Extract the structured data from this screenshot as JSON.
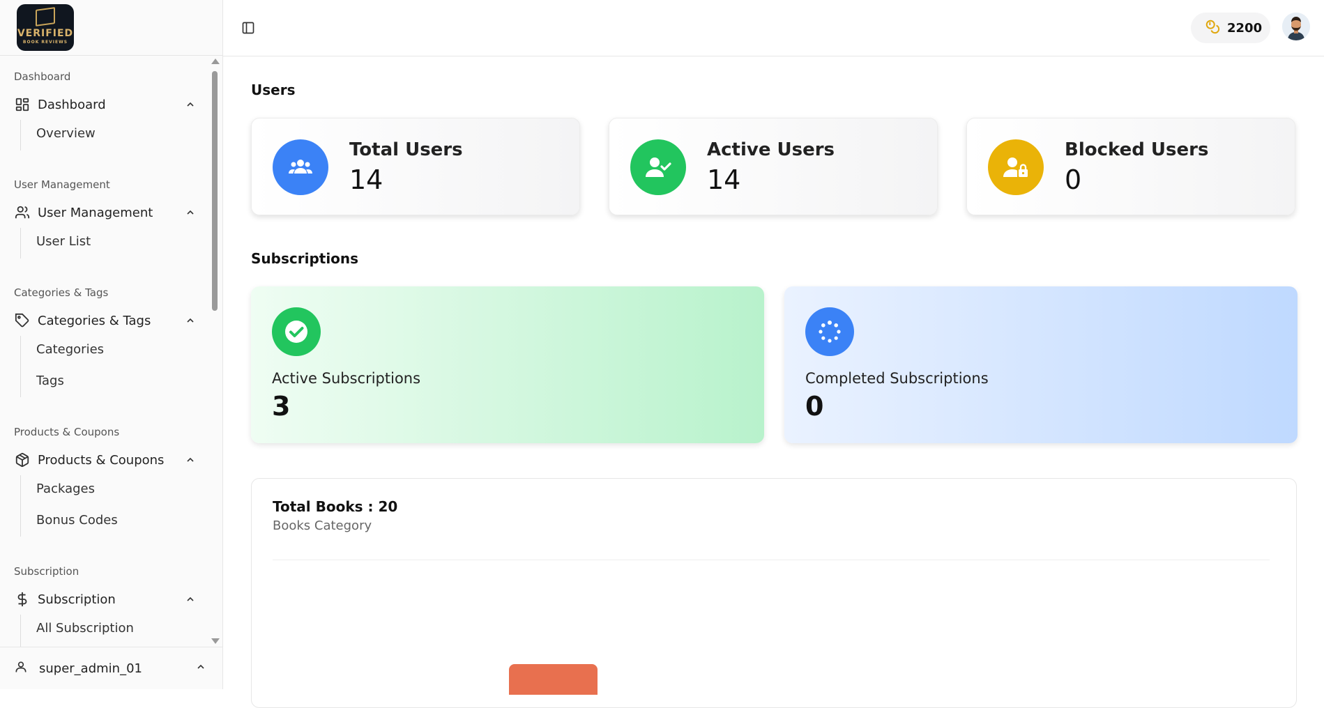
{
  "brand": {
    "logo_line1": "VERIFIED",
    "logo_line2": "BOOK REVIEWS"
  },
  "sidebar": {
    "sections": [
      {
        "label": "Dashboard",
        "parent": {
          "label": "Dashboard",
          "icon": "grid-icon"
        },
        "children": [
          "Overview"
        ]
      },
      {
        "label": "User Management",
        "parent": {
          "label": "User Management",
          "icon": "users-icon"
        },
        "children": [
          "User List"
        ]
      },
      {
        "label": "Categories & Tags",
        "parent": {
          "label": "Categories & Tags",
          "icon": "tag-icon"
        },
        "children": [
          "Categories",
          "Tags"
        ]
      },
      {
        "label": "Products & Coupons",
        "parent": {
          "label": "Products & Coupons",
          "icon": "package-icon"
        },
        "children": [
          "Packages",
          "Bonus Codes"
        ]
      },
      {
        "label": "Subscription",
        "parent": {
          "label": "Subscription",
          "icon": "dollar-icon"
        },
        "children": [
          "All Subscription"
        ]
      }
    ],
    "user": {
      "name": "super_admin_01",
      "icon": "user-icon"
    }
  },
  "header": {
    "coins": "2200",
    "coins_icon": "coins-icon"
  },
  "users_section": {
    "title": "Users",
    "cards": [
      {
        "title": "Total Users",
        "value": "14",
        "color": "#3b82f6",
        "icon": "users-group-icon"
      },
      {
        "title": "Active Users",
        "value": "14",
        "color": "#22c55e",
        "icon": "user-check-icon"
      },
      {
        "title": "Blocked Users",
        "value": "0",
        "color": "#eab308",
        "icon": "user-lock-icon"
      }
    ]
  },
  "subscriptions_section": {
    "title": "Subscriptions",
    "cards": [
      {
        "title": "Active Subscriptions",
        "value": "3",
        "color": "#22c55e",
        "icon": "check-circle-icon"
      },
      {
        "title": "Completed Subscriptions",
        "value": "0",
        "color": "#3b82f6",
        "icon": "loader-icon"
      }
    ]
  },
  "books_panel": {
    "title": "Total Books : 20",
    "subtitle": "Books Category",
    "bar_color": "#e8704f"
  },
  "chart_data": {
    "type": "bar",
    "title": "Total Books : 20",
    "subtitle": "Books Category",
    "categories": [],
    "values": [],
    "bar_color": "#e8704f"
  }
}
